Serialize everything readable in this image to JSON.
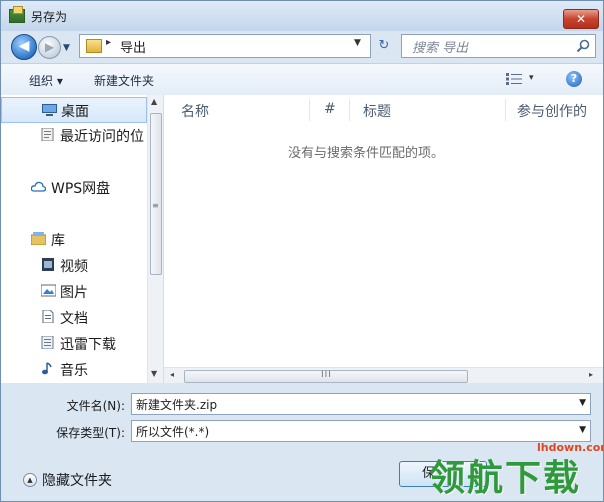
{
  "window": {
    "title": "另存为",
    "close_symbol": "✕"
  },
  "nav": {
    "back_symbol": "◀",
    "forward_symbol": "▶",
    "address_arrow": "▸",
    "address_path": "导出",
    "dropdown_symbol": "▼",
    "refresh_symbol": "↻",
    "search_placeholder": "搜索 导出"
  },
  "toolbar": {
    "organize_label": "组织 ▾",
    "new_folder_label": "新建文件夹",
    "view_dropdown": "▾",
    "help_label": "?"
  },
  "sidebar": {
    "items": [
      {
        "label": "桌面",
        "icon": "desktop-icon"
      },
      {
        "label": "最近访问的位",
        "icon": "recent-icon"
      },
      {
        "label": "WPS网盘",
        "icon": "cloud-icon"
      },
      {
        "label": "库",
        "icon": "library-icon"
      },
      {
        "label": "视频",
        "icon": "video-icon"
      },
      {
        "label": "图片",
        "icon": "picture-icon"
      },
      {
        "label": "文档",
        "icon": "document-icon"
      },
      {
        "label": "迅雷下载",
        "icon": "download-folder-icon"
      },
      {
        "label": "音乐",
        "icon": "music-icon"
      }
    ],
    "scroll_up": "▲",
    "scroll_down": "▼",
    "grip": "≡"
  },
  "columns": {
    "name": "名称",
    "number": "#",
    "title": "标题",
    "contributing_artist": "参与创作的"
  },
  "file_list": {
    "empty_message": "没有与搜索条件匹配的项。",
    "sort_indicator": "^"
  },
  "hscroll": {
    "left": "◂",
    "right": "▸",
    "grip": "III"
  },
  "form": {
    "filename_label": "文件名(N):",
    "filename_value": "新建文件夹.zip",
    "filetype_label": "保存类型(T):",
    "filetype_value": "所以文件(*.*)"
  },
  "footer": {
    "hide_folders_label": "隐藏文件夹",
    "hide_folders_symbol": "▲",
    "save_label": "保"
  },
  "watermark": {
    "url": "lhdown.com",
    "text": "领航下载"
  },
  "colors": {
    "accent": "#3c7fb1",
    "watermark_green": "#2f9a3b",
    "watermark_red": "#e0461f"
  }
}
